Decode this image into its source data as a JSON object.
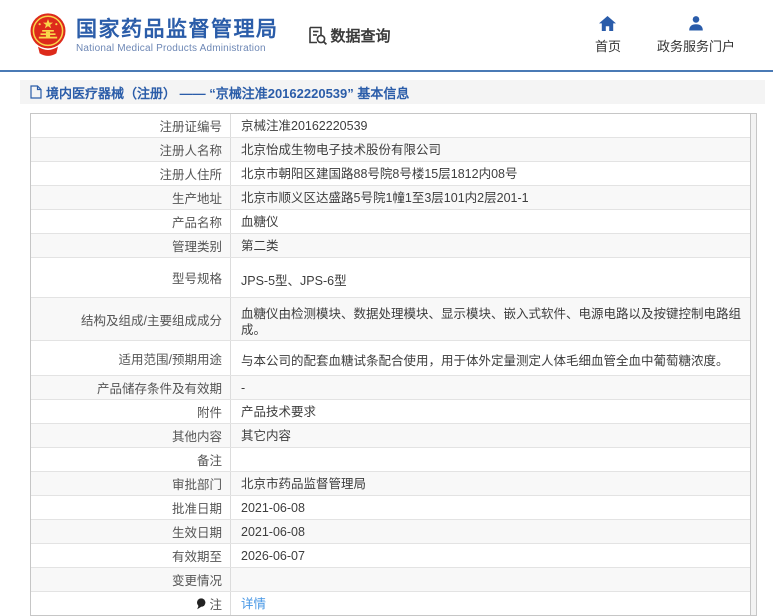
{
  "header": {
    "title": "国家药品监督管理局",
    "subtitle": "National Medical Products Administration",
    "data_query_label": "数据查询",
    "nav_home_label": "首页",
    "nav_portal_label": "政务服务门户"
  },
  "breadcrumb": {
    "text": "境内医疗器械（注册） —— “京械注准20162220539” 基本信息"
  },
  "table": {
    "rows": [
      {
        "label": "注册证编号",
        "value": "京械注准20162220539"
      },
      {
        "label": "注册人名称",
        "value": "北京怡成生物电子技术股份有限公司"
      },
      {
        "label": "注册人住所",
        "value": "北京市朝阳区建国路88号院8号楼15层1812内08号"
      },
      {
        "label": "生产地址",
        "value": "北京市顺义区达盛路5号院1幢1至3层101内2层201-1"
      },
      {
        "label": "产品名称",
        "value": "血糖仪"
      },
      {
        "label": "管理类别",
        "value": "第二类"
      },
      {
        "label": "型号规格",
        "value": "JPS-5型、JPS-6型"
      },
      {
        "label": "结构及组成/主要组成成分",
        "value": "血糖仪由检测模块、数据处理模块、显示模块、嵌入式软件、电源电路以及按键控制电路组成。"
      },
      {
        "label": "适用范围/预期用途",
        "value": "与本公司的配套血糖试条配合使用，用于体外定量测定人体毛细血管全血中葡萄糖浓度。"
      },
      {
        "label": "产品储存条件及有效期",
        "value": "-"
      },
      {
        "label": "附件",
        "value": "产品技术要求"
      },
      {
        "label": "其他内容",
        "value": "其它内容"
      },
      {
        "label": "备注",
        "value": ""
      },
      {
        "label": "审批部门",
        "value": "北京市药品监督管理局"
      },
      {
        "label": "批准日期",
        "value": "2021-06-08"
      },
      {
        "label": "生效日期",
        "value": "2021-06-08"
      },
      {
        "label": "有效期至",
        "value": "2026-06-07"
      },
      {
        "label": "变更情况",
        "value": ""
      },
      {
        "label": "注",
        "value": "详情"
      }
    ]
  },
  "icons": {
    "emblem": "national-emblem",
    "data_query": "doc-search-icon",
    "home": "home-icon",
    "portal": "user-icon",
    "breadcrumb": "document-icon",
    "note": "note-icon"
  },
  "colors": {
    "brand_blue": "#2b5da9",
    "icon_blue": "#2a5caa",
    "link_blue": "#4596e5",
    "emblem_red": "#dd2a1b",
    "header_rule_blue": "#4a7ab5",
    "breadcrumb_bg": "#f4f4f4",
    "row_stripe": "#f8f8f8"
  }
}
